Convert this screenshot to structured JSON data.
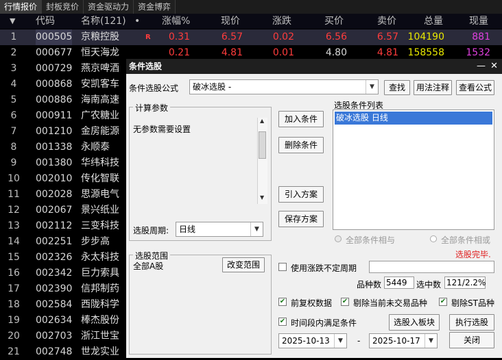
{
  "tabs": [
    "行情报价",
    "封板竞价",
    "资金驱动力",
    "资金博弈"
  ],
  "columns": {
    "code": "代码",
    "name": "名称(121)",
    "dot": "•",
    "change_pct": "涨幅%",
    "price": "现价",
    "change": "涨跌",
    "bid": "买价",
    "ask": "卖价",
    "volume": "总量",
    "cur_vol": "现量"
  },
  "rows": [
    {
      "idx": "1",
      "code": "000505",
      "name": "京粮控股",
      "flag": "R",
      "change_pct": "0.31",
      "price": "6.57",
      "change": "0.02",
      "bid": "6.56",
      "ask": "6.57",
      "volume": "104190",
      "cur_vol": "881"
    },
    {
      "idx": "2",
      "code": "000677",
      "name": "恒天海龙",
      "change_pct": "0.21",
      "price": "4.81",
      "change": "0.01",
      "bid": "4.80",
      "ask": "4.81",
      "volume": "158558",
      "cur_vol": "1532"
    },
    {
      "idx": "3",
      "code": "000729",
      "name": "燕京啤酒"
    },
    {
      "idx": "4",
      "code": "000868",
      "name": "安凯客车"
    },
    {
      "idx": "5",
      "code": "000886",
      "name": "海南高速"
    },
    {
      "idx": "6",
      "code": "000911",
      "name": "广农糖业"
    },
    {
      "idx": "7",
      "code": "001210",
      "name": "金房能源"
    },
    {
      "idx": "8",
      "code": "001338",
      "name": "永顺泰"
    },
    {
      "idx": "9",
      "code": "001380",
      "name": "华纬科技"
    },
    {
      "idx": "10",
      "code": "002010",
      "name": "传化智联"
    },
    {
      "idx": "11",
      "code": "002028",
      "name": "思源电气"
    },
    {
      "idx": "12",
      "code": "002067",
      "name": "景兴纸业"
    },
    {
      "idx": "13",
      "code": "002112",
      "name": "三变科技"
    },
    {
      "idx": "14",
      "code": "002251",
      "name": "步步高"
    },
    {
      "idx": "15",
      "code": "002326",
      "name": "永太科技"
    },
    {
      "idx": "16",
      "code": "002342",
      "name": "巨力索具"
    },
    {
      "idx": "17",
      "code": "002390",
      "name": "信邦制药"
    },
    {
      "idx": "18",
      "code": "002584",
      "name": "西陇科学"
    },
    {
      "idx": "19",
      "code": "002634",
      "name": "棒杰股份"
    },
    {
      "idx": "20",
      "code": "002703",
      "name": "浙江世宝"
    },
    {
      "idx": "21",
      "code": "002748",
      "name": "世龙实业"
    }
  ],
  "dialog": {
    "title": "条件选股",
    "formula_label": "条件选股公式",
    "formula_value": "破冰选股  -",
    "find_btn": "查找",
    "usage_btn": "用法注释",
    "view_btn": "查看公式",
    "calc_params_label": "计算参数",
    "no_params_text": "无参数需要设置",
    "add_btn": "加入条件",
    "del_btn": "删除条件",
    "list_label": "选股条件列表",
    "list_items": [
      "破冰选股  日线"
    ],
    "import_btn": "引入方案",
    "save_btn": "保存方案",
    "period_label": "选股周期:",
    "period_value": "日线",
    "radio_and": "全部条件相与",
    "radio_or": "全部条件相或",
    "status": "选股完毕.",
    "scope_label": "选股范围",
    "scope_value": "全部A股",
    "change_scope_btn": "改变范围",
    "variable_period_label": "使用涨跌不定周期",
    "count_label": "品种数",
    "count_value": "5449",
    "selected_label": "选中数",
    "selected_value": "121/2.2%",
    "forward_adj_label": "前复权数据",
    "exclude_no_trade_label": "剔除当前未交易品种",
    "exclude_st_label": "剔除ST品种",
    "time_range_label": "时间段内满足条件",
    "add_to_block_btn": "选股入板块",
    "execute_btn": "执行选股",
    "date_from": "2025-10-13",
    "date_sep": "-",
    "date_to": "2025-10-17",
    "close_btn": "关闭"
  },
  "colors": {
    "up": "#ff3c3c",
    "volume": "#e8e800",
    "cur_vol": "#e040e0",
    "list_highlight": "#3a78d8"
  }
}
